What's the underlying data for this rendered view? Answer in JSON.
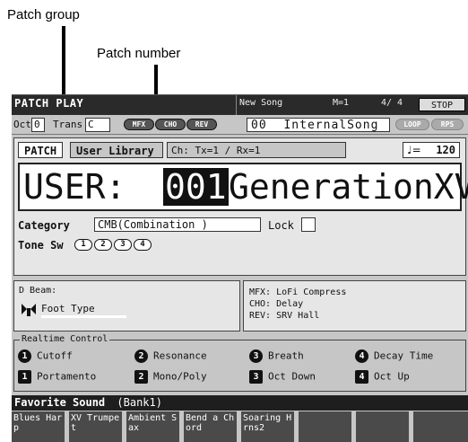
{
  "annotations": {
    "patch_group": "Patch group",
    "patch_number": "Patch number"
  },
  "titlebar": {
    "mode": "PATCH PLAY",
    "song": "New Song",
    "measure": "M=1",
    "time_sig": "4/ 4",
    "transport": "STOP"
  },
  "row2": {
    "oct_label": "Oct",
    "oct_value": "0",
    "trans_label": "Trans",
    "trans_value": "C",
    "fx_buttons": [
      "MFX",
      "CHO",
      "REV"
    ],
    "song_number": "00",
    "song_name": "InternalSong",
    "loop_label": "LOOP",
    "rps_label": "RPS"
  },
  "patch": {
    "tab_patch": "PATCH",
    "tab_library": "User Library",
    "channel": "Ch: Tx=1  / Rx=1",
    "tempo_icon": "quarter-note-icon",
    "tempo": "120",
    "group": "USER:",
    "number": "001",
    "name": "GenerationXV",
    "category_label": "Category",
    "category_value": "CMB(Combination )",
    "lock_label": "Lock",
    "tone_sw_label": "Tone Sw",
    "tone_switches": [
      "1",
      "2",
      "3",
      "4"
    ]
  },
  "dbeam": {
    "label": "D Beam:",
    "icon": "d-beam-icon",
    "value": "Foot Type"
  },
  "effects": {
    "mfx": "MFX: LoFi Compress",
    "cho": "CHO: Delay",
    "rev": "REV: SRV Hall"
  },
  "realtime": {
    "title": "Realtime Control",
    "items": [
      {
        "key": "1",
        "label": "Cutoff"
      },
      {
        "key": "2",
        "label": "Resonance"
      },
      {
        "key": "3",
        "label": "Breath"
      },
      {
        "key": "4",
        "label": "Decay Time"
      },
      {
        "key": "1",
        "label": "Portamento"
      },
      {
        "key": "2",
        "label": "Mono/Poly"
      },
      {
        "key": "3",
        "label": "Oct Down"
      },
      {
        "key": "4",
        "label": "Oct Up"
      }
    ]
  },
  "favorites": {
    "title": "Favorite Sound",
    "bank": "(Bank1)",
    "slots": [
      "Blues Harp",
      "XV Trumpet",
      "Ambient Sax",
      "Bend a Chord",
      "Soaring Hrns2",
      "",
      "",
      ""
    ]
  }
}
